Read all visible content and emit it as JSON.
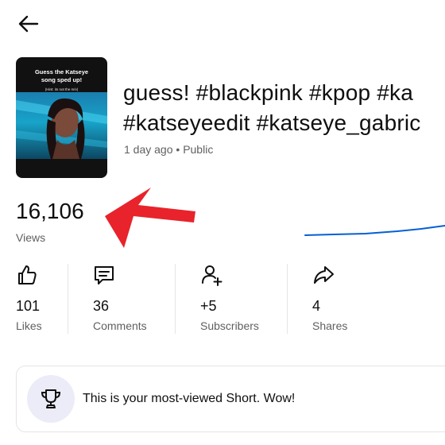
{
  "header": {
    "back_icon": "arrow-left-icon"
  },
  "video": {
    "thumbnail_caption_line1": "Guess the Katseye",
    "thumbnail_caption_line2": "song sped up!",
    "thumbnail_hint": "(Hint: its not the m/v)",
    "title_line1": "guess! #blackpink #kpop #ka",
    "title_line2": "#katseyeedit #katseye_gabric",
    "age": "1 day ago",
    "separator": "•",
    "visibility": "Public"
  },
  "views": {
    "count": "16,106",
    "label": "Views"
  },
  "stats": [
    {
      "icon": "thumbs-up-icon",
      "value": "101",
      "label": "Likes"
    },
    {
      "icon": "comment-icon",
      "value": "36",
      "label": "Comments"
    },
    {
      "icon": "add-person-icon",
      "value": "+5",
      "label": "Subscribers"
    },
    {
      "icon": "share-icon",
      "value": "4",
      "label": "Shares"
    }
  ],
  "achievement": {
    "icon": "trophy-icon",
    "text": "This is your most-viewed Short. Wow!"
  },
  "colors": {
    "accent_blue": "#065fd4",
    "annotation_red": "#e8232b",
    "trophy_bg": "#ececf8"
  }
}
